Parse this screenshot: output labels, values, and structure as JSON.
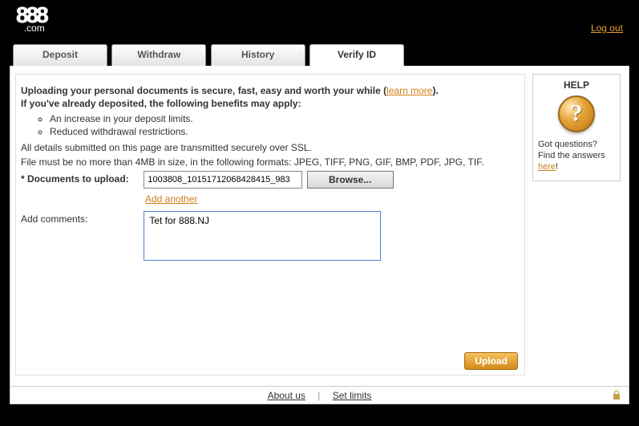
{
  "header": {
    "logo_top": "888",
    "logo_bottom": ".com",
    "logout": "Log out"
  },
  "tabs": [
    "Deposit",
    "Withdraw",
    "History",
    "Verify ID"
  ],
  "active_tab": 3,
  "content": {
    "intro_a": "Uploading your personal documents is secure, fast, easy and worth your while (",
    "learn_more": "learn more",
    "intro_b": ").",
    "intro2": "If you've already deposited, the following benefits may apply:",
    "benefits": [
      "An increase in your deposit limits.",
      "Reduced withdrawal restrictions."
    ],
    "ssl_line": "All details submitted on this page are transmitted securely over SSL.",
    "restrictions": "File must be no more than 4MB in size, in the following formats: JPEG, TIFF, PNG, GIF, BMP, PDF, JPG, TIF.",
    "doc_label": "* Documents to upload:",
    "file_value": "1003808_10151712068428415_983",
    "browse_label": "Browse...",
    "add_another": "Add another",
    "comments_label": "Add comments:",
    "comments_value": "Tet for 888.NJ",
    "upload_label": "Upload"
  },
  "help": {
    "title": "HELP",
    "line1": "Got questions?",
    "line2": "Find the answers",
    "link": "here",
    "punct": "!"
  },
  "footer": {
    "about": "About us",
    "limits": "Set limits"
  }
}
